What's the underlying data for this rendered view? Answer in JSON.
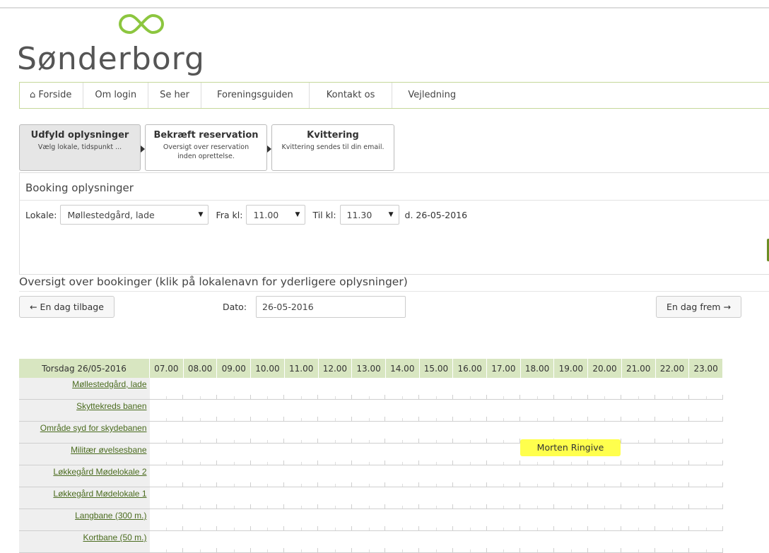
{
  "logo": {
    "text": "Sønderborg",
    "mark": "infinity-logo",
    "color": "#8cc63f"
  },
  "nav": {
    "items": [
      {
        "label": "Forside",
        "icon": "home-icon"
      },
      {
        "label": "Om login"
      },
      {
        "label": "Se her"
      },
      {
        "label": "Foreningsguiden"
      },
      {
        "label": "Kontakt os"
      },
      {
        "label": "Vejledning"
      }
    ]
  },
  "steps": [
    {
      "title": "Udfyld oplysninger",
      "sub": "Vælg lokale, tidspunkt ..."
    },
    {
      "title": "Bekræft reservation",
      "sub": "Oversigt over reservation inden oprettelse."
    },
    {
      "title": "Kvittering",
      "sub": "Kvittering sendes til din email."
    }
  ],
  "booking_form": {
    "title": "Booking oplysninger",
    "lokale_label": "Lokale:",
    "lokale_value": "Møllestedgård, lade",
    "fra_label": "Fra kl:",
    "fra_value": "11.00",
    "til_label": "Til kl:",
    "til_value": "11.30",
    "date_text": "d. 26-05-2016"
  },
  "overview": {
    "title": "Oversigt over bookinger (klik på lokalenavn for yderligere oplysninger)",
    "prev_label": "← En dag tilbage",
    "next_label": "En dag frem →",
    "date_label": "Dato:",
    "date_value": "26-05-2016"
  },
  "schedule": {
    "day_header": "Torsdag 26/05-2016",
    "hours": [
      "07.00",
      "08.00",
      "09.00",
      "10.00",
      "11.00",
      "12.00",
      "13.00",
      "14.00",
      "15.00",
      "16.00",
      "17.00",
      "18.00",
      "19.00",
      "20.00",
      "21.00",
      "22.00",
      "23.00"
    ],
    "rooms": [
      "Møllestedgård, lade",
      "Skyttekreds banen",
      "Område syd for skydebanen",
      "Militær øvelsesbane",
      "Løkkegård Mødelokale 2",
      "Løkkegård Mødelokale 1",
      "Langbane (300 m.)",
      "Kortbane (50 m.)"
    ],
    "booking": {
      "label": "Morten Ringive",
      "color": "#ffff4d"
    }
  }
}
